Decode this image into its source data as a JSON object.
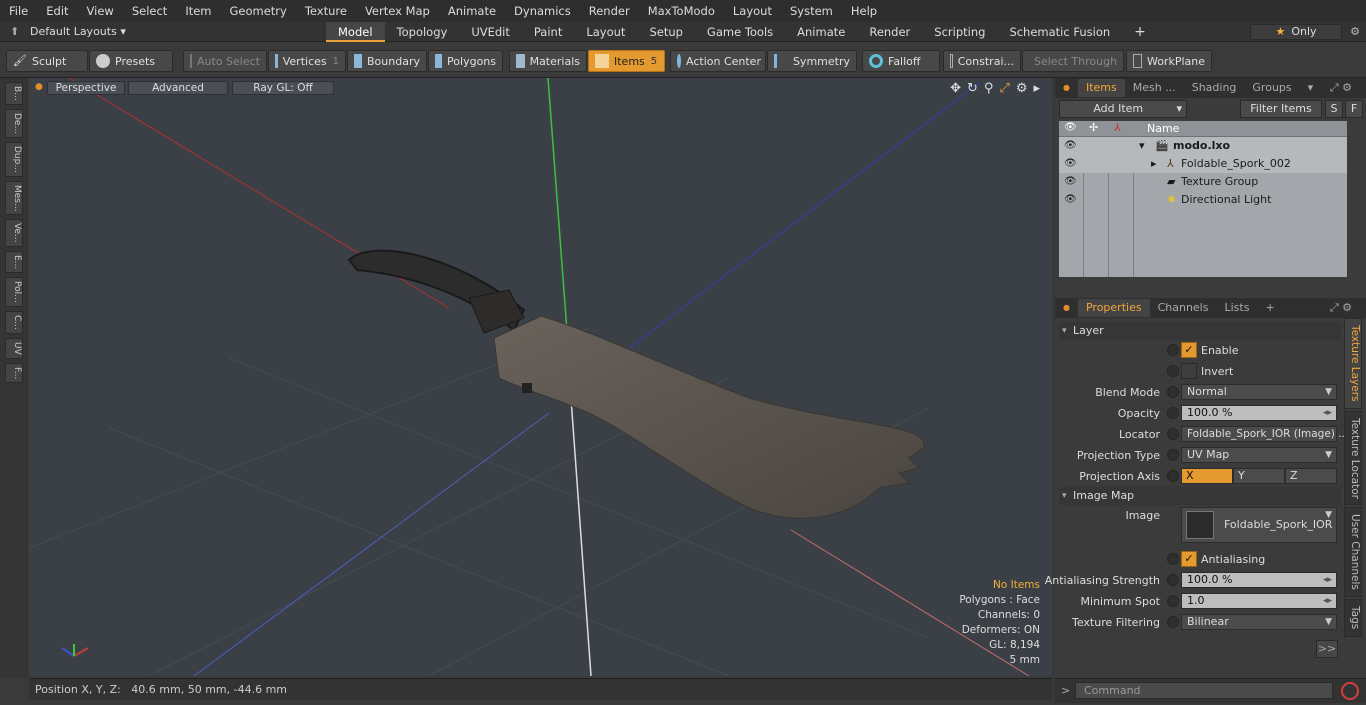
{
  "menu": [
    "File",
    "Edit",
    "View",
    "Select",
    "Item",
    "Geometry",
    "Texture",
    "Vertex Map",
    "Animate",
    "Dynamics",
    "Render",
    "MaxToModo",
    "Layout",
    "System",
    "Help"
  ],
  "layout_selector": "Default Layouts",
  "mode_tabs": [
    "Model",
    "Topology",
    "UVEdit",
    "Paint",
    "Layout",
    "Setup",
    "Game Tools",
    "Animate",
    "Render",
    "Scripting",
    "Schematic Fusion"
  ],
  "only_label": "Only",
  "toolbar": {
    "sculpt": "Sculpt",
    "presets": "Presets",
    "auto_select": "Auto Select",
    "vertices": "Vertices",
    "vertices_count": "1",
    "boundary": "Boundary",
    "polygons": "Polygons",
    "materials": "Materials",
    "items": "Items",
    "items_count": "5",
    "action_center": "Action Center",
    "symmetry": "Symmetry",
    "falloff": "Falloff",
    "constraints": "Constrai...",
    "select_through": "Select Through",
    "workplane": "WorkPlane"
  },
  "left_tabs": [
    "B...",
    "De...",
    "Dup...",
    "Mes...",
    "Ve...",
    "E...",
    "Pol...",
    "C...",
    "UV",
    "F..."
  ],
  "viewport": {
    "perspective": "Perspective",
    "advanced": "Advanced",
    "raygl": "Ray GL: Off",
    "info": {
      "no_items": "No Items",
      "polygons": "Polygons : Face",
      "channels": "Channels: 0",
      "deformers": "Deformers: ON",
      "gl": "GL: 8,194",
      "scale": "5 mm"
    }
  },
  "status": "Position X, Y, Z:   40.6 mm, 50 mm, -44.6 mm",
  "items_panel": {
    "tabs": [
      "Items",
      "Mesh ...",
      "Shading",
      "Groups"
    ],
    "add_item": "Add Item",
    "filter_items": "Filter Items",
    "s": "S",
    "f": "F",
    "name_header": "Name",
    "rows": [
      {
        "label": "modo.lxo"
      },
      {
        "label": "Foldable_Spork_002"
      },
      {
        "label": "Texture Group"
      },
      {
        "label": "Directional Light"
      }
    ]
  },
  "props_panel": {
    "tabs": [
      "Properties",
      "Channels",
      "Lists"
    ],
    "layer_section": "Layer",
    "enable": "Enable",
    "invert": "Invert",
    "blend_mode_label": "Blend Mode",
    "blend_mode": "Normal",
    "opacity_label": "Opacity",
    "opacity": "100.0 %",
    "locator_label": "Locator",
    "locator": "Foldable_Spork_IOR (Image) ...",
    "projection_type_label": "Projection Type",
    "projection_type": "UV Map",
    "projection_axis_label": "Projection Axis",
    "axes": [
      "X",
      "Y",
      "Z"
    ],
    "image_map_section": "Image Map",
    "image_label": "Image",
    "image_name": "Foldable_Spork_IOR",
    "antialiasing": "Antialiasing",
    "aa_strength_label": "Antialiasing Strength",
    "aa_strength": "100.0 %",
    "min_spot_label": "Minimum Spot",
    "min_spot": "1.0",
    "tex_filter_label": "Texture Filtering",
    "tex_filter": "Bilinear",
    "go": ">>"
  },
  "vertical_tabs": [
    "Texture Layers",
    "Texture Locator",
    "User Channels",
    "Tags"
  ],
  "command_placeholder": "Command"
}
